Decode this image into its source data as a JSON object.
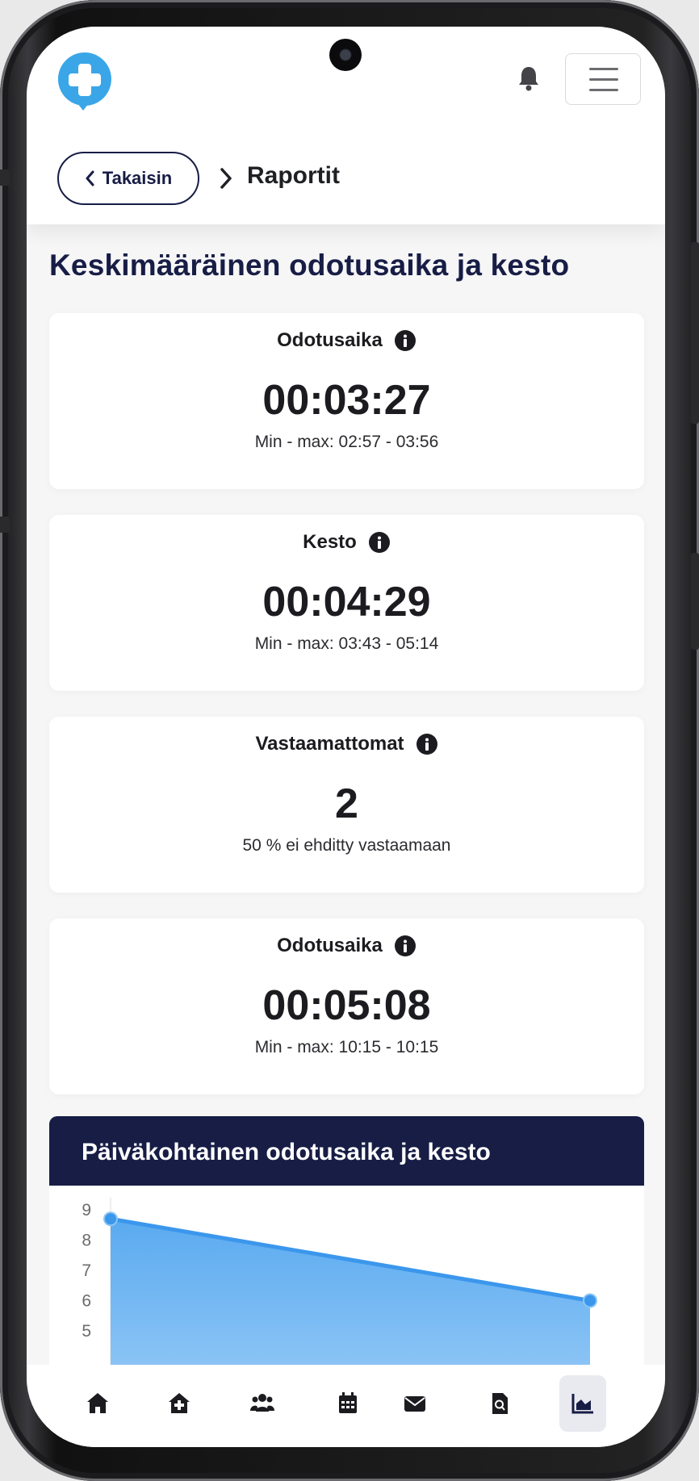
{
  "header": {
    "back_label": "Takaisin",
    "breadcrumb_title": "Raportit"
  },
  "page_title": "Keskimääräinen odotusaika ja kesto",
  "cards": [
    {
      "label": "Odotusaika",
      "value": "00:03:27",
      "sub": "Min - max: 02:57 - 03:56"
    },
    {
      "label": "Kesto",
      "value": "00:04:29",
      "sub": "Min - max: 03:43 - 05:14"
    },
    {
      "label": "Vastaamattomat",
      "value": "2",
      "sub": "50 % ei ehditty vastaamaan"
    },
    {
      "label": "Odotusaika",
      "value": "00:05:08",
      "sub": "Min - max: 10:15 - 10:15"
    }
  ],
  "chart_title": "Päiväkohtainen odotusaika ja kesto",
  "chart_data": {
    "type": "area",
    "x": [
      1,
      2
    ],
    "series": [
      {
        "values": [
          8.7,
          6.0
        ]
      }
    ],
    "yticks": [
      "9",
      "8",
      "7",
      "6",
      "5"
    ],
    "ylim": [
      5,
      9
    ],
    "color": "#3b97ec"
  },
  "nav": {
    "items": [
      "home-icon",
      "house-medical-icon",
      "users-icon",
      "calendar-icon",
      "envelope-icon",
      "file-search-icon",
      "chart-area-icon"
    ],
    "active_index": 6
  },
  "colors": {
    "navy": "#171d45",
    "accent": "#3aa6e8"
  }
}
